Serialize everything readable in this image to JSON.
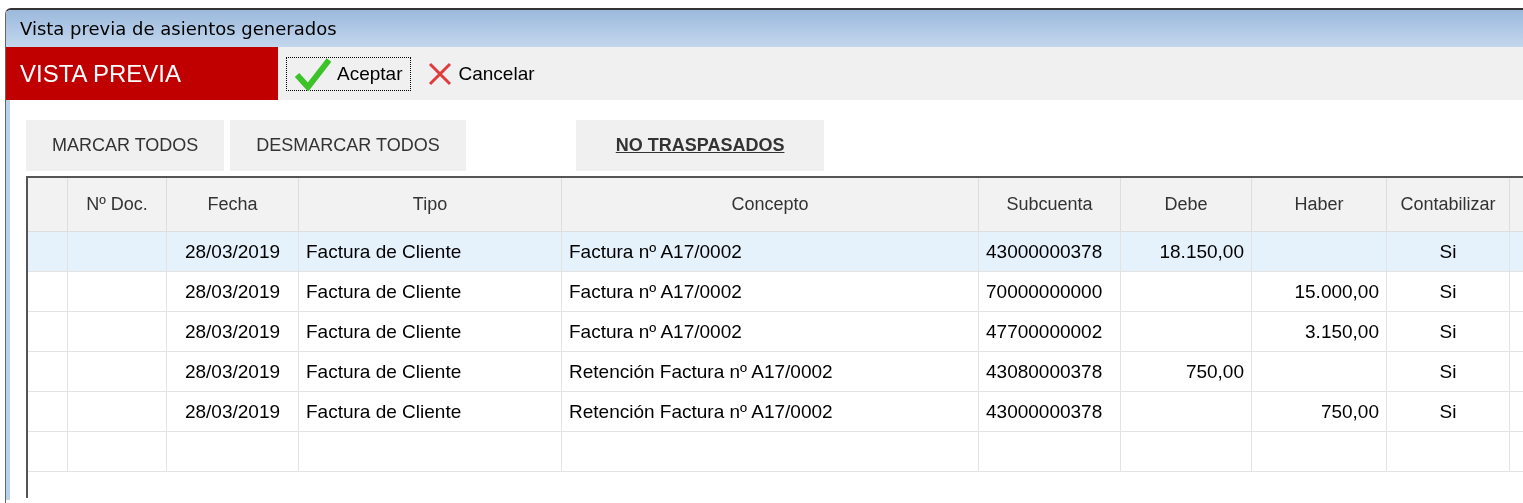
{
  "window": {
    "title": "Vista previa de asientos generados"
  },
  "toolbar": {
    "mode_label": "VISTA PREVIA",
    "buttons": [
      {
        "kind": "accept",
        "label": "Aceptar",
        "focused": true
      },
      {
        "kind": "cancel",
        "label": "Cancelar",
        "focused": false
      }
    ]
  },
  "actions": [
    {
      "label": "MARCAR TODOS",
      "emphasis": false
    },
    {
      "label": "DESMARCAR TODOS",
      "emphasis": false
    },
    {
      "label": "NO TRASPASADOS",
      "emphasis": true
    }
  ],
  "table": {
    "columns": [
      "",
      "Nº Doc.",
      "Fecha",
      "Tipo",
      "Concepto",
      "Subcuenta",
      "Debe",
      "Haber",
      "Contabilizar"
    ],
    "rows": [
      {
        "selected": true,
        "cells": [
          "",
          "",
          "28/03/2019",
          "Factura de Cliente",
          "Factura nº A17/0002",
          "43000000378",
          "18.150,00",
          "",
          "Si"
        ]
      },
      {
        "selected": false,
        "cells": [
          "",
          "",
          "28/03/2019",
          "Factura de Cliente",
          "Factura nº A17/0002",
          "70000000000",
          "",
          "15.000,00",
          "Si"
        ]
      },
      {
        "selected": false,
        "cells": [
          "",
          "",
          "28/03/2019",
          "Factura de Cliente",
          "Factura nº A17/0002",
          "47700000002",
          "",
          "3.150,00",
          "Si"
        ]
      },
      {
        "selected": false,
        "cells": [
          "",
          "",
          "28/03/2019",
          "Factura de Cliente",
          "Retención Factura nº A17/0002",
          "43080000378",
          "750,00",
          "",
          "Si"
        ]
      },
      {
        "selected": false,
        "cells": [
          "",
          "",
          "28/03/2019",
          "Factura de Cliente",
          "Retención Factura nº A17/0002",
          "43000000378",
          "",
          "750,00",
          "Si"
        ]
      }
    ]
  }
}
